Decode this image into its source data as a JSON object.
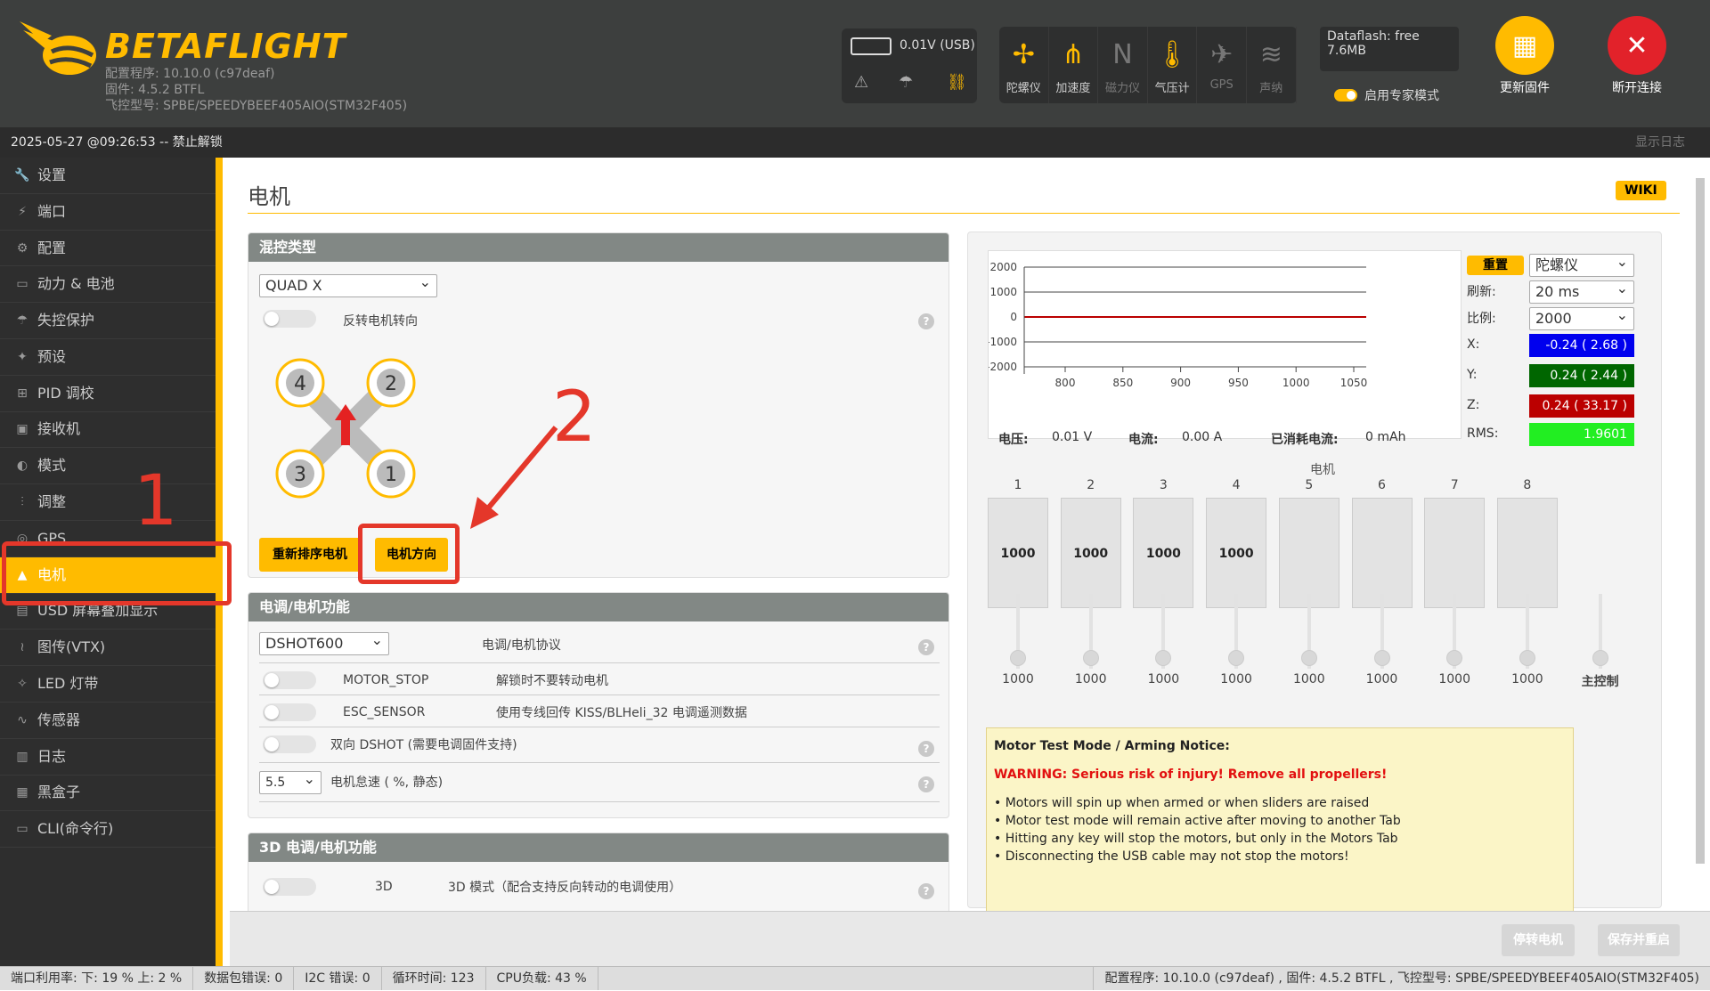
{
  "header": {
    "brand": "BETAFLIGHT",
    "configurator": "配置程序: 10.10.0 (c97deaf)",
    "firmware": "固件: 4.5.2 BTFL",
    "target": "飞控型号: SPBE/SPEEDYBEEF405AIO(STM32F405)",
    "battery": "0.01V (USB)",
    "sensors": [
      {
        "label": "陀螺仪",
        "icon": "gyro-icon",
        "active": true
      },
      {
        "label": "加速度",
        "icon": "accel-icon",
        "active": true
      },
      {
        "label": "磁力仪",
        "icon": "mag-icon",
        "active": false
      },
      {
        "label": "气压计",
        "icon": "baro-icon",
        "active": true
      },
      {
        "label": "GPS",
        "icon": "gps-icon",
        "active": false
      },
      {
        "label": "声纳",
        "icon": "sonar-icon",
        "active": false
      }
    ],
    "dataflash": "Dataflash: free 7.6MB",
    "expert_mode": "启用专家模式",
    "update_firmware": "更新固件",
    "disconnect": "断开连接",
    "colors": {
      "accent": "#ffbb00",
      "disconnect": "#e2222a"
    }
  },
  "status_bar": {
    "text": "2025-05-27 @09:26:53 -- 禁止解锁",
    "show_log": "显示日志"
  },
  "sidebar": [
    {
      "label": "设置",
      "icon": "wrench-icon"
    },
    {
      "label": "端口",
      "icon": "plug-icon"
    },
    {
      "label": "配置",
      "icon": "gear-icon"
    },
    {
      "label": "动力 & 电池",
      "icon": "battery-icon"
    },
    {
      "label": "失控保护",
      "icon": "parachute-icon"
    },
    {
      "label": "预设",
      "icon": "wand-icon"
    },
    {
      "label": "PID 调校",
      "icon": "sitemap-icon"
    },
    {
      "label": "接收机",
      "icon": "receiver-icon"
    },
    {
      "label": "模式",
      "icon": "toggle-icon"
    },
    {
      "label": "调整",
      "icon": "sliders-icon"
    },
    {
      "label": "GPS",
      "icon": "globe-icon"
    },
    {
      "label": "电机",
      "icon": "motor-icon",
      "active": true
    },
    {
      "label": "USD 屏幕叠加显示",
      "icon": "osd-icon"
    },
    {
      "label": "图传(VTX)",
      "icon": "vtx-icon"
    },
    {
      "label": "LED 灯带",
      "icon": "led-icon"
    },
    {
      "label": "传感器",
      "icon": "pulse-icon"
    },
    {
      "label": "日志",
      "icon": "log-icon"
    },
    {
      "label": "黑盒子",
      "icon": "blackbox-icon"
    },
    {
      "label": "CLI(命令行)",
      "icon": "terminal-icon"
    }
  ],
  "page": {
    "title": "电机",
    "wiki": "WIKI"
  },
  "mixer": {
    "heading": "混控类型",
    "type": "QUAD X",
    "reverse_label": "反转电机转向",
    "motors": [
      "4",
      "2",
      "3",
      "1"
    ],
    "reorder_button": "重新排序电机",
    "direction_button": "电机方向"
  },
  "esc": {
    "heading": "电调/电机功能",
    "protocol": "DSHOT600",
    "protocol_label": "电调/电机协议",
    "motor_stop": "MOTOR_STOP",
    "motor_stop_desc": "解锁时不要转动电机",
    "esc_sensor": "ESC_SENSOR",
    "esc_sensor_desc": "使用专线回传 KISS/BLHeli_32 电调遥测数据",
    "bidir": "双向 DSHOT (需要电调固件支持)",
    "idle_value": "5.5",
    "idle_label": "电机怠速 ( %, 静态)"
  },
  "esc3d": {
    "heading": "3D 电调/电机功能",
    "label": "3D",
    "desc": "3D 模式（配合支持反向转动的电调使用）"
  },
  "graph": {
    "reset": "重置",
    "sensor": "陀螺仪",
    "refresh_label": "刷新:",
    "refresh": "20 ms",
    "scale_label": "比例:",
    "scale": "2000",
    "x_label": "X:",
    "x": "-0.24 ( 2.68 )",
    "y_label": "Y:",
    "y": "0.24 ( 2.44 )",
    "z_label": "Z:",
    "z": "0.24 ( 33.17 )",
    "rms_label": "RMS:",
    "rms": "1.9601",
    "voltage_label": "电压:",
    "voltage": "0.01 V",
    "current_label": "电流:",
    "current": "0.00 A",
    "consumed_label": "已消耗电流:",
    "consumed": "0 mAh",
    "chart_data": {
      "type": "line",
      "y_ticks": [
        "2000",
        "1000",
        "0",
        "-1000",
        "-2000"
      ],
      "x_ticks": [
        "800",
        "850",
        "900",
        "950",
        "1000",
        "1050"
      ],
      "ylim": [
        -2000,
        2000
      ]
    }
  },
  "motors": {
    "heading": "电机",
    "numbers": [
      "1",
      "2",
      "3",
      "4",
      "5",
      "6",
      "7",
      "8"
    ],
    "box_values": [
      "1000",
      "1000",
      "1000",
      "1000",
      "",
      "",
      "",
      ""
    ],
    "slider_values": [
      "1000",
      "1000",
      "1000",
      "1000",
      "1000",
      "1000",
      "1000",
      "1000"
    ],
    "master": "主控制"
  },
  "notice": {
    "title": "Motor Test Mode / Arming Notice:",
    "warning": "WARNING: Serious risk of injury! Remove all propellers!",
    "lines": [
      "• Motors will spin up when armed or when sliders are raised",
      "• Motor test mode will remain active after moving to another Tab",
      "• Hitting any key will stop the motors, but only in the Motors Tab",
      "• Disconnecting the USB cable may not stop the motors!"
    ]
  },
  "footer": {
    "stop": "停转电机",
    "save": "保存并重启"
  },
  "bottom": {
    "port": "端口利用率: 下: 19 % 上: 2 %",
    "packet": "数据包错误: 0",
    "i2c": "I2C 错误: 0",
    "cycle": "循环时间: 123",
    "cpu": "CPU负载: 43 %",
    "version": "配置程序: 10.10.0 (c97deaf) , 固件: 4.5.2 BTFL , 飞控型号: SPBE/SPEEDYBEEF405AIO(STM32F405)"
  },
  "annotations": {
    "one": "1",
    "two": "2"
  }
}
